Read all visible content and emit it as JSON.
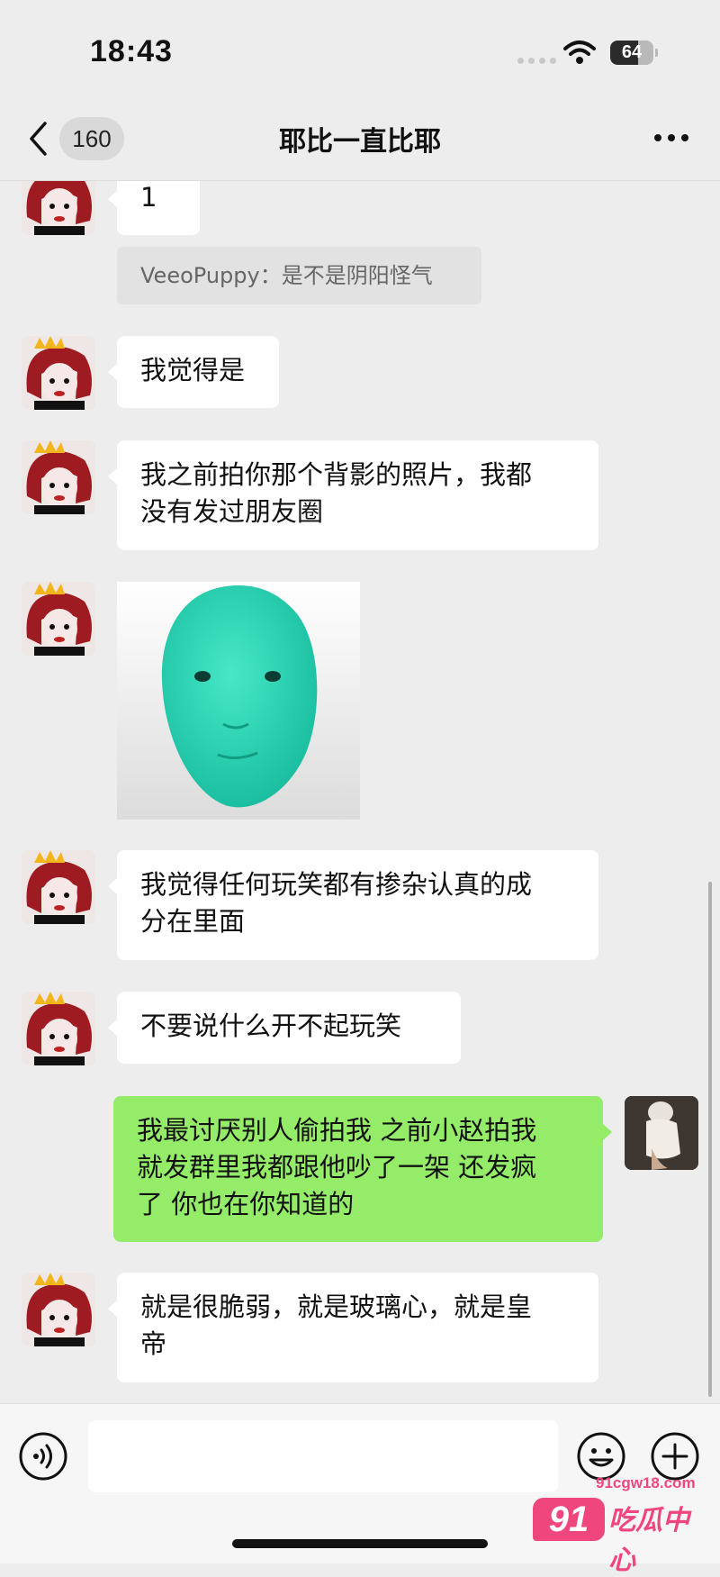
{
  "status_bar": {
    "time": "18:43",
    "battery": "64",
    "battery_level_percent": 64,
    "icons": [
      "signal-dots-icon",
      "wifi-icon",
      "battery-icon"
    ]
  },
  "nav": {
    "back_icon": "chevron-left-icon",
    "unread_count": "160",
    "title": "耶比一直比耶",
    "more_icon": "more-dots-icon"
  },
  "messages": [
    {
      "side": "left",
      "type": "text",
      "text": "1"
    },
    {
      "side": "left",
      "type": "quote",
      "text": "VeeoPuppy：是不是阴阳怪气"
    },
    {
      "side": "left",
      "type": "text",
      "text": "我觉得是"
    },
    {
      "side": "left",
      "type": "text",
      "lines": [
        "我之前拍你那个背影的照片，我都",
        "没有发过朋友圈"
      ]
    },
    {
      "side": "left",
      "type": "sticker",
      "description_icon": "green-face-sticker"
    },
    {
      "side": "left",
      "type": "text",
      "lines": [
        "我觉得任何玩笑都有掺杂认真的成",
        "分在里面"
      ]
    },
    {
      "side": "left",
      "type": "text",
      "text": "不要说什么开不起玩笑"
    },
    {
      "side": "right",
      "type": "text",
      "lines": [
        "我最讨厌别人偷拍我 之前小赵拍我",
        "就发群里我都跟他吵了一架 还发疯",
        "了 你也在你知道的"
      ]
    },
    {
      "side": "left",
      "type": "text",
      "lines": [
        "就是很脆弱，就是玻璃心，就是皇",
        "帝"
      ]
    }
  ],
  "input_bar": {
    "voice_icon": "voice-icon",
    "input_value": "",
    "emoji_icon": "emoji-icon",
    "plus_icon": "plus-icon"
  },
  "watermark": {
    "badge": "91",
    "url": "91cgw18.com",
    "name": "吃瓜中心"
  },
  "colors": {
    "background": "#ededed",
    "left_bubble": "#ffffff",
    "right_bubble": "#95ec69",
    "quote_bg": "#e2e2e2",
    "watermark": "#f0467e"
  }
}
